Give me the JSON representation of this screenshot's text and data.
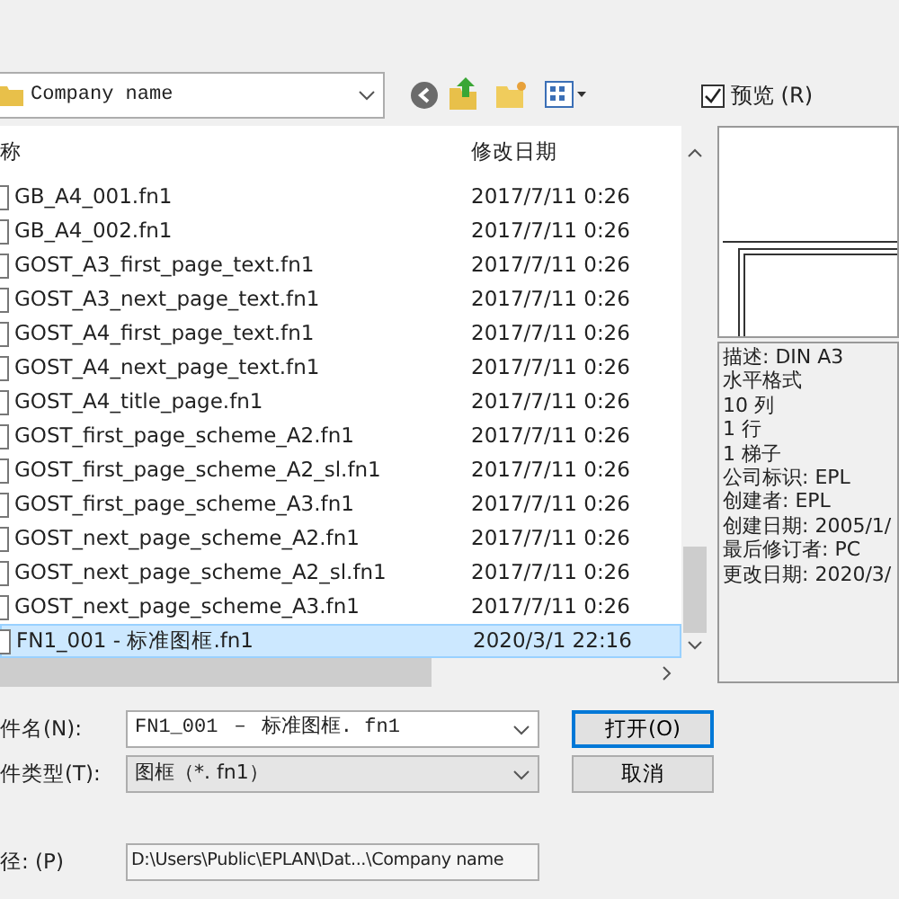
{
  "location": {
    "value": "Company name"
  },
  "preview_toggle": {
    "label": "预览 (R)",
    "checked": true
  },
  "file_list": {
    "columns": [
      "称",
      "修改日期"
    ],
    "rows": [
      {
        "name": "GB_A4_001.fn1",
        "modified": "2017/7/11 0:26",
        "selected": false
      },
      {
        "name": "GB_A4_002.fn1",
        "modified": "2017/7/11 0:26",
        "selected": false
      },
      {
        "name": "GOST_A3_first_page_text.fn1",
        "modified": "2017/7/11 0:26",
        "selected": false
      },
      {
        "name": "GOST_A3_next_page_text.fn1",
        "modified": "2017/7/11 0:26",
        "selected": false
      },
      {
        "name": "GOST_A4_first_page_text.fn1",
        "modified": "2017/7/11 0:26",
        "selected": false
      },
      {
        "name": "GOST_A4_next_page_text.fn1",
        "modified": "2017/7/11 0:26",
        "selected": false
      },
      {
        "name": "GOST_A4_title_page.fn1",
        "modified": "2017/7/11 0:26",
        "selected": false
      },
      {
        "name": "GOST_first_page_scheme_A2.fn1",
        "modified": "2017/7/11 0:26",
        "selected": false
      },
      {
        "name": "GOST_first_page_scheme_A2_sl.fn1",
        "modified": "2017/7/11 0:26",
        "selected": false
      },
      {
        "name": "GOST_first_page_scheme_A3.fn1",
        "modified": "2017/7/11 0:26",
        "selected": false
      },
      {
        "name": "GOST_next_page_scheme_A2.fn1",
        "modified": "2017/7/11 0:26",
        "selected": false
      },
      {
        "name": "GOST_next_page_scheme_A2_sl.fn1",
        "modified": "2017/7/11 0:26",
        "selected": false
      },
      {
        "name": "GOST_next_page_scheme_A3.fn1",
        "modified": "2017/7/11 0:26",
        "selected": false
      },
      {
        "name": "FN1_001 - 标准图框.fn1",
        "modified": "2020/3/1 22:16",
        "selected": true
      }
    ]
  },
  "preview": {
    "info_lines": [
      "描述: DIN A3",
      "水平格式",
      "10 列",
      "1 行",
      "1 梯子",
      "公司标识: EPL",
      "创建者: EPL",
      "创建日期: 2005/1/",
      "最后修订者: PC",
      "更改日期: 2020/3/"
    ]
  },
  "file_name": {
    "label": "件名(N):",
    "value": "FN1_001 － 标准图框. fn1"
  },
  "file_type": {
    "label": "件类型(T):",
    "value": "图框（*. fn1）"
  },
  "path": {
    "label": "径: (P)",
    "value": "D:\\Users\\Public\\EPLAN\\Dat...\\Company name"
  },
  "buttons": [
    {
      "label": "打开(O)",
      "default": true
    },
    {
      "label": "取消",
      "default": false
    }
  ]
}
